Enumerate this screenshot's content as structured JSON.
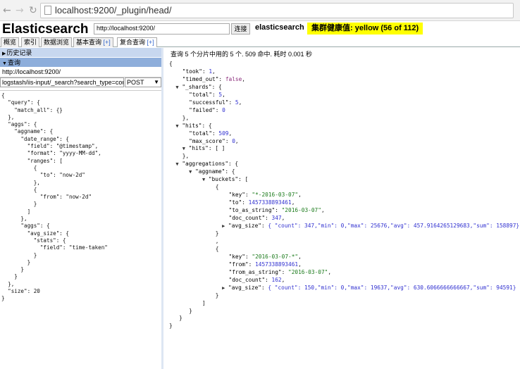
{
  "browser": {
    "url": "localhost:9200/_plugin/head/"
  },
  "header": {
    "brand": "Elasticsearch",
    "connect_url": "http://localhost:9200/",
    "connect_button": "连接",
    "cluster_name": "elasticsearch",
    "health": "集群健康值: yellow (56 of 112)",
    "health_color": "#ffff00"
  },
  "tabs": [
    {
      "label": "概览"
    },
    {
      "label": "索引"
    },
    {
      "label": "数据浏览"
    },
    {
      "label": "基本查询",
      "plus": "[+]"
    },
    {
      "label": "复合查询",
      "plus": "[+]"
    }
  ],
  "left": {
    "history_label": "历史记录",
    "query_label": "查询",
    "server_url": "http://localhost:9200/",
    "path": "logstash/iis-input/_search?search_type=count",
    "method": "POST",
    "body": "{\n  \"query\": {\n    \"match_all\": {}\n  },\n  \"aggs\": {\n    \"aggname\": {\n      \"date_range\": {\n        \"field\": \"@timestamp\",\n        \"format\": \"yyyy-MM-dd\",\n        \"ranges\": [\n          {\n            \"to\": \"now-2d\"\n          },\n          {\n            \"from\": \"now-2d\"\n          }\n        ]\n      },\n      \"aggs\": {\n        \"avg_size\": {\n          \"stats\": {\n            \"field\": \"time-taken\"\n          }\n        }\n      }\n    }\n  },\n  \"size\": 20\n}"
  },
  "right": {
    "summary": "查询 5 个分片中用的 5 个. 509 命中. 耗时 0.001 秒",
    "took": "1",
    "timed_out": "false",
    "shards": {
      "total": "5",
      "successful": "5",
      "failed": "0"
    },
    "hits": {
      "total": "509",
      "max_score": "0",
      "hits": "[ ]"
    },
    "bucket1": {
      "key": "\"*-2016-03-07\"",
      "to": "1457338893461",
      "to_as_string": "\"2016-03-07\"",
      "doc_count": "347",
      "avg_size": "{ \"count\": 347,\"min\": 0,\"max\": 25676,\"avg\": 457.9164265129683,\"sum\": 158897}"
    },
    "bucket2": {
      "key": "\"2016-03-07-*\"",
      "from": "1457338893461",
      "from_as_string": "\"2016-03-07\"",
      "doc_count": "162",
      "avg_size": "{ \"count\": 150,\"min\": 0,\"max\": 19637,\"avg\": 630.6066666666667,\"sum\": 94591}"
    }
  },
  "icons": {
    "back": "back-arrow-icon",
    "forward": "forward-arrow-icon",
    "reload": "reload-icon",
    "page": "page-icon"
  }
}
